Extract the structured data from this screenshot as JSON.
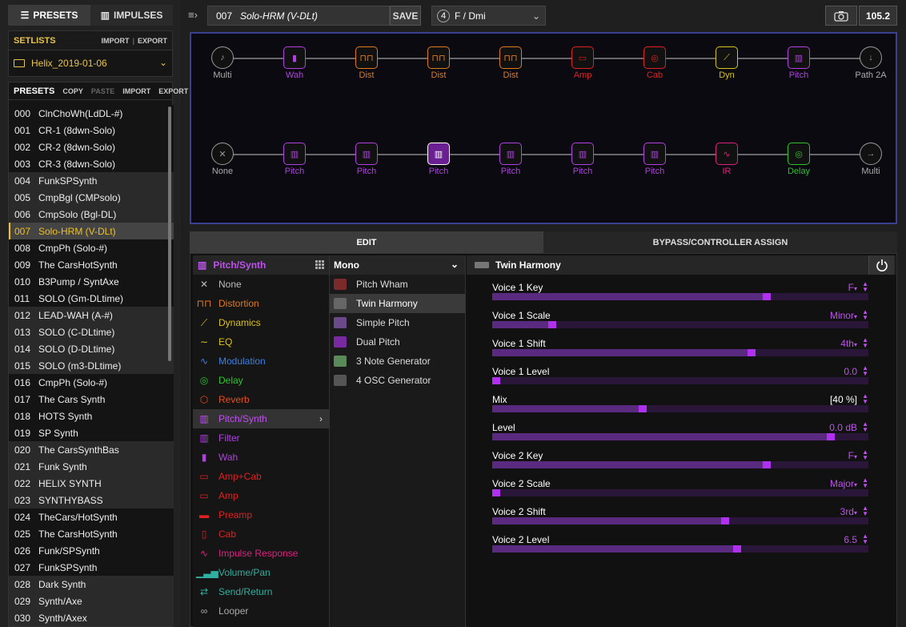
{
  "app": {
    "tabs": [
      {
        "label": "PRESETS",
        "icon": "list-icon"
      },
      {
        "label": "IMPULSES",
        "icon": "waveform-icon"
      }
    ]
  },
  "setlists": {
    "title": "SETLISTS",
    "import": "IMPORT",
    "export": "EXPORT",
    "selected": "Helix_2019-01-06"
  },
  "presets": {
    "title": "PRESETS",
    "copy": "COPY",
    "paste": "PASTE",
    "import": "IMPORT",
    "export": "EXPORT",
    "selected_index": 7,
    "items": [
      {
        "num": "000",
        "name": "ClnChoWh(LdDL-#)"
      },
      {
        "num": "001",
        "name": "CR-1 (8dwn-Solo)"
      },
      {
        "num": "002",
        "name": "CR-2 (8dwn-Solo)"
      },
      {
        "num": "003",
        "name": "CR-3 (8dwn-Solo)"
      },
      {
        "num": "004",
        "name": "FunkSPSynth"
      },
      {
        "num": "005",
        "name": "CmpBgl (CMPsolo)"
      },
      {
        "num": "006",
        "name": "CmpSolo (Bgl-DL)"
      },
      {
        "num": "007",
        "name": "Solo-HRM (V-DLt)"
      },
      {
        "num": "008",
        "name": "CmpPh (Solo-#)"
      },
      {
        "num": "009",
        "name": "The CarsHotSynth"
      },
      {
        "num": "010",
        "name": "B3Pump / SyntAxe"
      },
      {
        "num": "011",
        "name": "SOLO (Gm-DLtime)"
      },
      {
        "num": "012",
        "name": "LEAD-WAH (A-#)"
      },
      {
        "num": "013",
        "name": "SOLO (C-DLtime)"
      },
      {
        "num": "014",
        "name": "SOLO (D-DLtime)"
      },
      {
        "num": "015",
        "name": "SOLO (m3-DLtime)"
      },
      {
        "num": "016",
        "name": "CmpPh (Solo-#)"
      },
      {
        "num": "017",
        "name": "The Cars Synth"
      },
      {
        "num": "018",
        "name": "HOTS Synth"
      },
      {
        "num": "019",
        "name": "SP Synth"
      },
      {
        "num": "020",
        "name": "The CarsSynthBas"
      },
      {
        "num": "021",
        "name": "Funk Synth"
      },
      {
        "num": "022",
        "name": "HELIX SYNTH"
      },
      {
        "num": "023",
        "name": "SYNTHYBASS"
      },
      {
        "num": "024",
        "name": "TheCars/HotSynth"
      },
      {
        "num": "025",
        "name": "The CarsHotSynth"
      },
      {
        "num": "026",
        "name": "Funk/SPSynth"
      },
      {
        "num": "027",
        "name": "FunkSPSynth"
      },
      {
        "num": "028",
        "name": "Dark Synth"
      },
      {
        "num": "029",
        "name": "Synth/Axe"
      },
      {
        "num": "030",
        "name": "Synth/Axex"
      }
    ]
  },
  "topbar": {
    "preset_num": "007",
    "preset_name": "Solo-HRM (V-DLt)",
    "save": "SAVE",
    "snapshot_num": "4",
    "key": "F / Dmi",
    "tempo": "105.2"
  },
  "chain": {
    "row1": [
      {
        "label": "Multi",
        "color": "#999999",
        "icon": "input-guitar-icon"
      },
      {
        "label": "Wah",
        "color": "#b040e0",
        "icon": "wah-pedal-icon"
      },
      {
        "label": "Dist",
        "color": "#e07a20",
        "icon": "distortion-icon"
      },
      {
        "label": "Dist",
        "color": "#e07a20",
        "icon": "distortion-icon"
      },
      {
        "label": "Dist",
        "color": "#e07a20",
        "icon": "distortion-icon"
      },
      {
        "label": "Amp",
        "color": "#e02020",
        "icon": "amp-icon"
      },
      {
        "label": "Cab",
        "color": "#e02020",
        "icon": "cab-icon"
      },
      {
        "label": "Dyn",
        "color": "#d8c020",
        "icon": "dynamics-icon"
      },
      {
        "label": "Pitch",
        "color": "#b040e0",
        "icon": "pitch-icon"
      },
      {
        "label": "Path 2A",
        "color": "#999999",
        "icon": "path-output-icon"
      }
    ],
    "row2": [
      {
        "label": "None",
        "color": "#999999",
        "icon": "none-input-icon"
      },
      {
        "label": "Pitch",
        "color": "#b040e0",
        "icon": "pitch-icon"
      },
      {
        "label": "Pitch",
        "color": "#b040e0",
        "icon": "pitch-icon"
      },
      {
        "label": "Pitch",
        "color": "#b040e0",
        "icon": "pitch-icon",
        "selected": true
      },
      {
        "label": "Pitch",
        "color": "#b040e0",
        "icon": "pitch-icon"
      },
      {
        "label": "Pitch",
        "color": "#b040e0",
        "icon": "pitch-icon"
      },
      {
        "label": "Pitch",
        "color": "#b040e0",
        "icon": "pitch-icon"
      },
      {
        "label": "IR",
        "color": "#e02080",
        "icon": "impulse-response-icon"
      },
      {
        "label": "Delay",
        "color": "#30c030",
        "icon": "delay-icon"
      },
      {
        "label": "Multi",
        "color": "#999999",
        "icon": "output-arrow-icon"
      }
    ]
  },
  "edit_tabs": [
    "EDIT",
    "BYPASS/CONTROLLER ASSIGN"
  ],
  "categories": {
    "header": "Pitch/Synth",
    "items": [
      {
        "label": "None",
        "color": "#bbbbbb",
        "icon": "x-icon"
      },
      {
        "label": "Distortion",
        "color": "#e07a20",
        "icon": "distortion-icon"
      },
      {
        "label": "Dynamics",
        "color": "#d8c020",
        "icon": "dynamics-icon"
      },
      {
        "label": "EQ",
        "color": "#d8c020",
        "icon": "eq-icon"
      },
      {
        "label": "Modulation",
        "color": "#3a80e0",
        "icon": "modulation-icon"
      },
      {
        "label": "Delay",
        "color": "#30c030",
        "icon": "delay-icon"
      },
      {
        "label": "Reverb",
        "color": "#e05020",
        "icon": "reverb-icon"
      },
      {
        "label": "Pitch/Synth",
        "color": "#c050f0",
        "icon": "pitch-icon",
        "selected": true
      },
      {
        "label": "Filter",
        "color": "#b040e0",
        "icon": "filter-icon"
      },
      {
        "label": "Wah",
        "color": "#b040e0",
        "icon": "wah-pedal-icon"
      },
      {
        "label": "Amp+Cab",
        "color": "#e02020",
        "icon": "amp-cab-icon"
      },
      {
        "label": "Amp",
        "color": "#e02020",
        "icon": "amp-icon"
      },
      {
        "label": "Preamp",
        "color": "#e02020",
        "icon": "preamp-icon"
      },
      {
        "label": "Cab",
        "color": "#e02020",
        "icon": "cab-icon"
      },
      {
        "label": "Impulse Response",
        "color": "#e02080",
        "icon": "impulse-response-icon"
      },
      {
        "label": "Volume/Pan",
        "color": "#30b0a0",
        "icon": "volume-icon"
      },
      {
        "label": "Send/Return",
        "color": "#30b0a0",
        "icon": "send-return-icon"
      },
      {
        "label": "Looper",
        "color": "#aaaaaa",
        "icon": "looper-icon"
      }
    ]
  },
  "models": {
    "header": "Mono",
    "items": [
      {
        "label": "Pitch Wham",
        "icon": "pitch-wham-icon"
      },
      {
        "label": "Twin Harmony",
        "icon": "twin-harmony-icon",
        "selected": true
      },
      {
        "label": "Simple Pitch",
        "icon": "simple-pitch-icon"
      },
      {
        "label": "Dual Pitch",
        "icon": "dual-pitch-icon"
      },
      {
        "label": "3 Note Generator",
        "icon": "note-generator-icon"
      },
      {
        "label": "4 OSC Generator",
        "icon": "osc-generator-icon"
      }
    ]
  },
  "params": {
    "header": "Twin Harmony",
    "items": [
      {
        "label": "Voice 1 Key",
        "value": "F",
        "dropdown": true,
        "level": 0.73
      },
      {
        "label": "Voice 1 Scale",
        "value": "Minor",
        "dropdown": true,
        "level": 0.16
      },
      {
        "label": "Voice 1 Shift",
        "value": "4th",
        "dropdown": true,
        "level": 0.69
      },
      {
        "label": "Voice 1 Level",
        "value": "0.0",
        "dropdown": false,
        "level": 0.01
      },
      {
        "label": "Mix",
        "value": "[40 %]",
        "dropdown": false,
        "level": 0.4,
        "white": true
      },
      {
        "label": "Level",
        "value": "0.0 dB",
        "dropdown": false,
        "level": 0.9
      },
      {
        "label": "Voice 2 Key",
        "value": "F",
        "dropdown": true,
        "level": 0.73
      },
      {
        "label": "Voice 2 Scale",
        "value": "Major",
        "dropdown": true,
        "level": 0.01
      },
      {
        "label": "Voice 2 Shift",
        "value": "3rd",
        "dropdown": true,
        "level": 0.62
      },
      {
        "label": "Voice 2 Level",
        "value": "6.5",
        "dropdown": false,
        "level": 0.65
      }
    ]
  }
}
